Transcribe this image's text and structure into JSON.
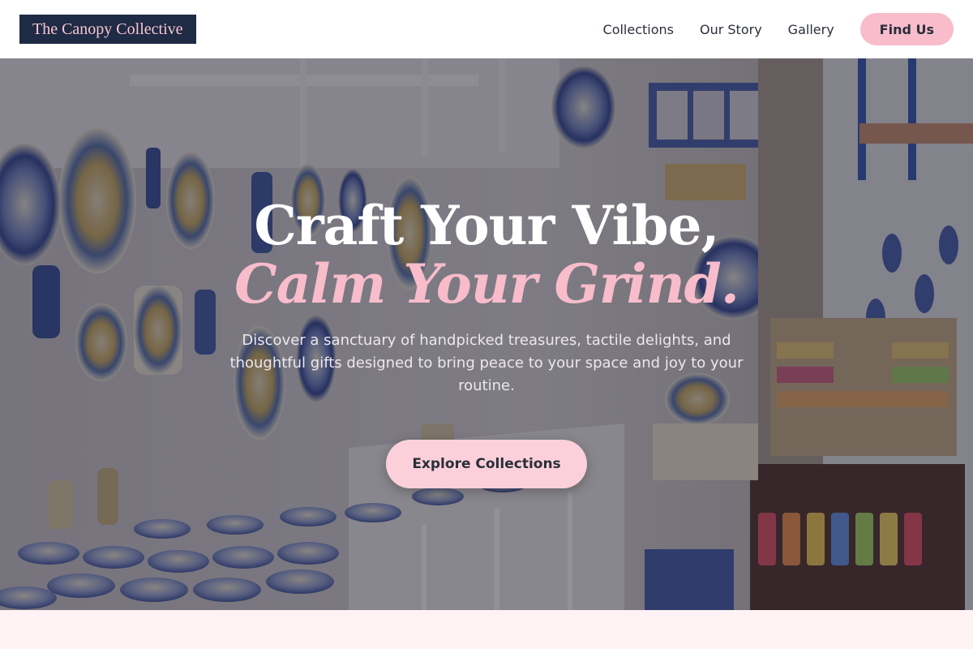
{
  "header": {
    "logo": "The Canopy Collective",
    "nav": [
      {
        "label": "Collections"
      },
      {
        "label": "Our Story"
      },
      {
        "label": "Gallery"
      }
    ],
    "cta_label": "Find Us"
  },
  "hero": {
    "headline_line1": "Craft Your Vibe,",
    "headline_line2": "Calm Your Grind.",
    "subtitle": "Discover a sanctuary of handpicked treasures, tactile delights, and thoughtful gifts designed to bring peace to your space and joy to your routine.",
    "cta_label": "Explore Collections",
    "image_subject": "shop-wall-of-ceramic-plates"
  },
  "colors": {
    "brand_navy": "#1f2a44",
    "accent_pink": "#f8bccb",
    "page_bg": "#fff2f5"
  }
}
